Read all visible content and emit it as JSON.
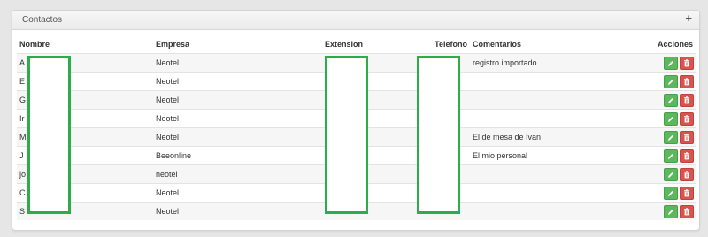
{
  "panel": {
    "title": "Contactos"
  },
  "table": {
    "headers": {
      "nombre": "Nombre",
      "empresa": "Empresa",
      "extension": "Extension",
      "telefono": "Telefono",
      "comentarios": "Comentarios",
      "acciones": "Acciones"
    },
    "rows": [
      {
        "nombre": "A",
        "empresa": "Neotel",
        "extension": "",
        "telefono": "",
        "comentarios": "registro importado"
      },
      {
        "nombre": "E",
        "empresa": "Neotel",
        "extension": "",
        "telefono": "",
        "comentarios": ""
      },
      {
        "nombre": "G",
        "empresa": "Neotel",
        "extension": "",
        "telefono": "",
        "comentarios": ""
      },
      {
        "nombre": "Ir",
        "empresa": "Neotel",
        "extension": "",
        "telefono": "",
        "comentarios": ""
      },
      {
        "nombre": "M",
        "empresa": "Neotel",
        "extension": "",
        "telefono": "",
        "comentarios": "El de mesa de Ivan"
      },
      {
        "nombre": "J",
        "empresa": "Beeonline",
        "extension": "",
        "telefono": "",
        "comentarios": "El mio personal"
      },
      {
        "nombre": "jo",
        "empresa": "neotel",
        "extension": "",
        "telefono": "",
        "comentarios": ""
      },
      {
        "nombre": "C",
        "empresa": "Neotel",
        "extension": "",
        "telefono": "",
        "comentarios": ""
      },
      {
        "nombre": "S",
        "empresa": "Neotel",
        "extension": "",
        "telefono": "",
        "comentarios": ""
      }
    ]
  },
  "colors": {
    "edit_button": "#5cb85c",
    "delete_button": "#d9534f",
    "redaction_border": "#2aad4a"
  },
  "icons": {
    "add": "plus-icon",
    "edit": "pencil-icon",
    "delete": "trash-icon"
  }
}
